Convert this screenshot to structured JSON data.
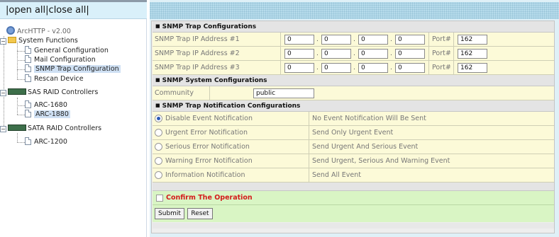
{
  "tree": {
    "open_all": "open all",
    "close_all": "close all",
    "root": "ArcHTTP - v2.00",
    "system_functions": "System Functions",
    "system_items": [
      "General Configuration",
      "Mail Configuration",
      "SNMP Trap Configuration",
      "Rescan Device"
    ],
    "selected_system_item": "SNMP Trap Configuration",
    "sas_group": "SAS RAID Controllers",
    "sas_items": [
      "ARC-1680",
      "ARC-1880"
    ],
    "selected_controller": "ARC-1880",
    "sata_group": "SATA RAID Controllers",
    "sata_items": [
      "ARC-1200"
    ]
  },
  "trap_config": {
    "title": "SNMP Trap Configurations",
    "port_label": "Port#",
    "rows": [
      {
        "label": "SNMP Trap IP Address #1",
        "ip": [
          "0",
          "0",
          "0",
          "0"
        ],
        "port": "162"
      },
      {
        "label": "SNMP Trap IP Address #2",
        "ip": [
          "0",
          "0",
          "0",
          "0"
        ],
        "port": "162"
      },
      {
        "label": "SNMP Trap IP Address #3",
        "ip": [
          "0",
          "0",
          "0",
          "0"
        ],
        "port": "162"
      }
    ]
  },
  "system_config": {
    "title": "SNMP System Configurations",
    "community_label": "Community",
    "community_value": "public"
  },
  "notification": {
    "title": "SNMP Trap Notification Configurations",
    "options": [
      {
        "label": "Disable Event Notification",
        "desc": "No Event Notification Will Be Sent",
        "checked": true
      },
      {
        "label": "Urgent Error Notification",
        "desc": "Send Only Urgent Event",
        "checked": false
      },
      {
        "label": "Serious Error Notification",
        "desc": "Send Urgent And Serious Event",
        "checked": false
      },
      {
        "label": "Warning Error Notification",
        "desc": "Send Urgent, Serious And Warning Event",
        "checked": false
      },
      {
        "label": "Information Notification",
        "desc": "Send All Event",
        "checked": false
      }
    ]
  },
  "confirm": {
    "label": "Confirm The Operation",
    "checked": false
  },
  "buttons": {
    "submit": "Submit",
    "reset": "Reset"
  },
  "colors": {
    "confirm_text": "#d41b1b",
    "row_bg": "#fcfad8",
    "confirm_bg": "#d9f5c4"
  }
}
